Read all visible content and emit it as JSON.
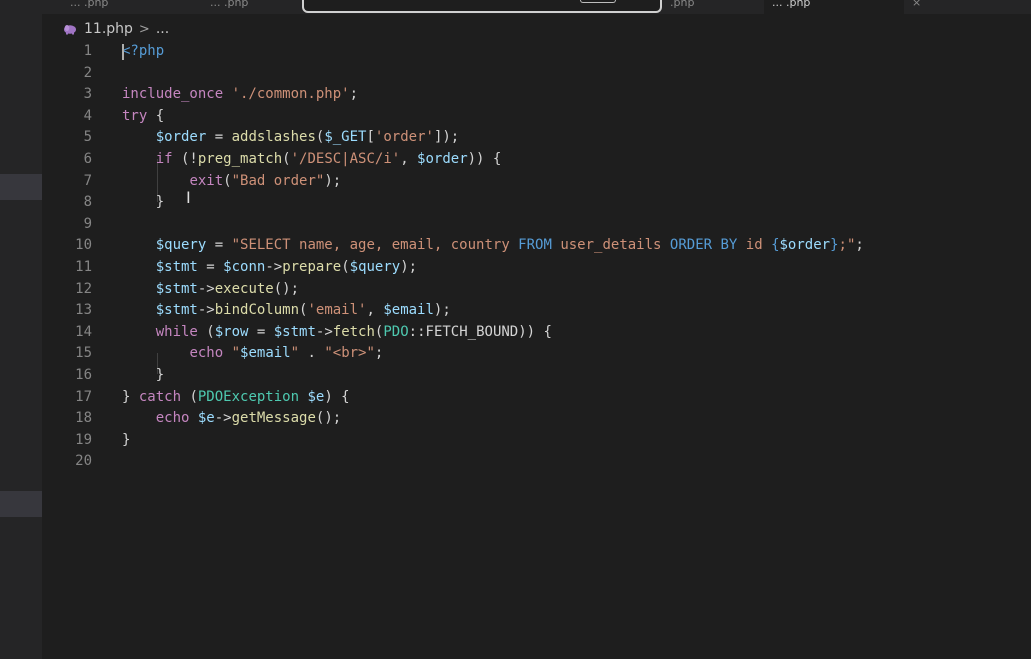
{
  "tabs": [
    {
      "label": "... .php"
    },
    {
      "label": "... .php"
    },
    {
      "label": ".php"
    },
    {
      "label": "... .php"
    },
    {
      "label": "×"
    }
  ],
  "breadcrumb": {
    "file": "11.php",
    "separator": ">",
    "ellipsis": "..."
  },
  "colors": {
    "background": "#1e1e1e",
    "keyword": "#569cd6",
    "variable": "#9cdcfe",
    "function": "#dcdcaa",
    "string": "#ce9178",
    "class": "#4ec9b0",
    "php_icon": "#a074c4"
  },
  "icons": {
    "breadcrumb_file": "php-elephant-icon"
  },
  "editor": {
    "line_numbers": [
      "1",
      "2",
      "3",
      "4",
      "5",
      "6",
      "7",
      "8",
      "9",
      "10",
      "11",
      "12",
      "13",
      "14",
      "15",
      "16",
      "17",
      "18",
      "19",
      "20"
    ],
    "lines": {
      "l1": [
        {
          "t": "<?php",
          "c": "tag"
        }
      ],
      "l2": [],
      "l3": [
        {
          "t": "include_once ",
          "c": "ctl"
        },
        {
          "t": "'./common.php'",
          "c": "str"
        },
        {
          "t": ";",
          "c": "plain"
        }
      ],
      "l4": [
        {
          "t": "try",
          "c": "ctl"
        },
        {
          "t": " {",
          "c": "plain"
        }
      ],
      "l5": [
        {
          "t": "    ",
          "c": "plain"
        },
        {
          "t": "$order",
          "c": "var"
        },
        {
          "t": " = ",
          "c": "plain"
        },
        {
          "t": "addslashes",
          "c": "fn"
        },
        {
          "t": "(",
          "c": "plain"
        },
        {
          "t": "$_GET",
          "c": "var"
        },
        {
          "t": "[",
          "c": "plain"
        },
        {
          "t": "'order'",
          "c": "str"
        },
        {
          "t": "]);",
          "c": "plain"
        }
      ],
      "l6": [
        {
          "t": "    ",
          "c": "plain"
        },
        {
          "t": "if",
          "c": "ctl"
        },
        {
          "t": " (!",
          "c": "plain"
        },
        {
          "t": "preg_match",
          "c": "fn"
        },
        {
          "t": "(",
          "c": "plain"
        },
        {
          "t": "'/DESC|ASC/i'",
          "c": "str"
        },
        {
          "t": ", ",
          "c": "plain"
        },
        {
          "t": "$order",
          "c": "var"
        },
        {
          "t": ")) {",
          "c": "plain"
        }
      ],
      "l7": [
        {
          "t": "        ",
          "c": "plain"
        },
        {
          "t": "exit",
          "c": "ctl"
        },
        {
          "t": "(",
          "c": "plain"
        },
        {
          "t": "\"Bad order\"",
          "c": "str"
        },
        {
          "t": ");",
          "c": "plain"
        }
      ],
      "l8": [
        {
          "t": "    }",
          "c": "plain"
        }
      ],
      "l9": [],
      "l10": [
        {
          "t": "    ",
          "c": "plain"
        },
        {
          "t": "$query",
          "c": "var"
        },
        {
          "t": " = ",
          "c": "plain"
        },
        {
          "t": "\"SELECT name, age, email, country ",
          "c": "str"
        },
        {
          "t": "FROM",
          "c": "kw"
        },
        {
          "t": " user_details ",
          "c": "str"
        },
        {
          "t": "ORDER BY",
          "c": "kw"
        },
        {
          "t": " id ",
          "c": "str"
        },
        {
          "t": "{",
          "c": "kw"
        },
        {
          "t": "$order",
          "c": "var"
        },
        {
          "t": "}",
          "c": "kw"
        },
        {
          "t": ";\"",
          "c": "str"
        },
        {
          "t": ";",
          "c": "plain"
        }
      ],
      "l11": [
        {
          "t": "    ",
          "c": "plain"
        },
        {
          "t": "$stmt",
          "c": "var"
        },
        {
          "t": " = ",
          "c": "plain"
        },
        {
          "t": "$conn",
          "c": "var"
        },
        {
          "t": "->",
          "c": "plain"
        },
        {
          "t": "prepare",
          "c": "fn"
        },
        {
          "t": "(",
          "c": "plain"
        },
        {
          "t": "$query",
          "c": "var"
        },
        {
          "t": ");",
          "c": "plain"
        }
      ],
      "l12": [
        {
          "t": "    ",
          "c": "plain"
        },
        {
          "t": "$stmt",
          "c": "var"
        },
        {
          "t": "->",
          "c": "plain"
        },
        {
          "t": "execute",
          "c": "fn"
        },
        {
          "t": "();",
          "c": "plain"
        }
      ],
      "l13": [
        {
          "t": "    ",
          "c": "plain"
        },
        {
          "t": "$stmt",
          "c": "var"
        },
        {
          "t": "->",
          "c": "plain"
        },
        {
          "t": "bindColumn",
          "c": "fn"
        },
        {
          "t": "(",
          "c": "plain"
        },
        {
          "t": "'email'",
          "c": "str"
        },
        {
          "t": ", ",
          "c": "plain"
        },
        {
          "t": "$email",
          "c": "var"
        },
        {
          "t": ");",
          "c": "plain"
        }
      ],
      "l14": [
        {
          "t": "    ",
          "c": "plain"
        },
        {
          "t": "while",
          "c": "ctl"
        },
        {
          "t": " (",
          "c": "plain"
        },
        {
          "t": "$row",
          "c": "var"
        },
        {
          "t": " = ",
          "c": "plain"
        },
        {
          "t": "$stmt",
          "c": "var"
        },
        {
          "t": "->",
          "c": "plain"
        },
        {
          "t": "fetch",
          "c": "fn"
        },
        {
          "t": "(",
          "c": "plain"
        },
        {
          "t": "PDO",
          "c": "cls"
        },
        {
          "t": "::FETCH_BOUND)) {",
          "c": "plain"
        }
      ],
      "l15": [
        {
          "t": "        ",
          "c": "plain"
        },
        {
          "t": "echo",
          "c": "ctl"
        },
        {
          "t": " ",
          "c": "plain"
        },
        {
          "t": "\"",
          "c": "str"
        },
        {
          "t": "$email",
          "c": "var"
        },
        {
          "t": "\"",
          "c": "str"
        },
        {
          "t": " . ",
          "c": "plain"
        },
        {
          "t": "\"<br>\"",
          "c": "str"
        },
        {
          "t": ";",
          "c": "plain"
        }
      ],
      "l16": [
        {
          "t": "    }",
          "c": "plain"
        }
      ],
      "l17": [
        {
          "t": "} ",
          "c": "plain"
        },
        {
          "t": "catch",
          "c": "ctl"
        },
        {
          "t": " (",
          "c": "plain"
        },
        {
          "t": "PDOException",
          "c": "cls"
        },
        {
          "t": " ",
          "c": "plain"
        },
        {
          "t": "$e",
          "c": "var"
        },
        {
          "t": ") {",
          "c": "plain"
        }
      ],
      "l18": [
        {
          "t": "    ",
          "c": "plain"
        },
        {
          "t": "echo",
          "c": "ctl"
        },
        {
          "t": " ",
          "c": "plain"
        },
        {
          "t": "$e",
          "c": "var"
        },
        {
          "t": "->",
          "c": "plain"
        },
        {
          "t": "getMessage",
          "c": "fn"
        },
        {
          "t": "();",
          "c": "plain"
        }
      ],
      "l19": [
        {
          "t": "}",
          "c": "plain"
        }
      ],
      "l20": []
    }
  }
}
